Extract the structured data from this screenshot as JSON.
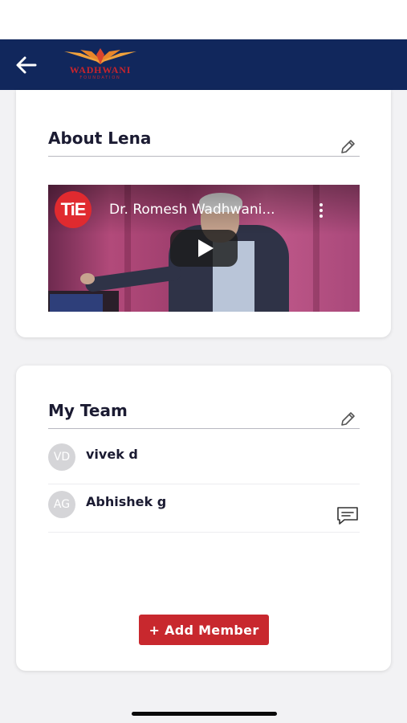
{
  "header": {
    "back_icon": "arrow-left-icon",
    "logo_text": "WADHWANI",
    "logo_subtext": "FOUNDATION",
    "background_color": "#11275c"
  },
  "about": {
    "title": "About Lena",
    "edit_icon": "pencil-icon",
    "video": {
      "channel_logo_text": "TiE",
      "title": "Dr. Romesh Wadhwani...",
      "more_icon": "more-vertical-icon",
      "play_icon": "play-icon"
    }
  },
  "team": {
    "title": "My Team",
    "edit_icon": "pencil-icon",
    "members": [
      {
        "initials": "VD",
        "name": "vivek d",
        "chat": false
      },
      {
        "initials": "AG",
        "name": "Abhishek g",
        "chat": true
      }
    ],
    "chat_icon": "message-icon",
    "add_button_label": "+ Add Member"
  },
  "colors": {
    "accent_red": "#c8282e",
    "navy": "#11275c"
  }
}
